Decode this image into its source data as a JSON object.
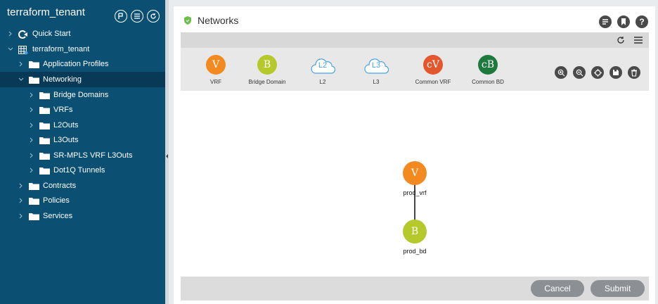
{
  "sidebar": {
    "title": "terraform_tenant",
    "header_icons": [
      "flag-icon",
      "list-icon",
      "refresh-icon"
    ],
    "items": [
      {
        "label": "Quick Start",
        "icon": "quick-start-icon"
      },
      {
        "label": "terraform_tenant",
        "icon": "tenant-icon"
      },
      {
        "label": "Application Profiles",
        "icon": "folder-icon"
      },
      {
        "label": "Networking",
        "icon": "folder-icon"
      },
      {
        "label": "Bridge Domains",
        "icon": "folder-icon"
      },
      {
        "label": "VRFs",
        "icon": "folder-icon"
      },
      {
        "label": "L2Outs",
        "icon": "folder-icon"
      },
      {
        "label": "L3Outs",
        "icon": "folder-icon"
      },
      {
        "label": "SR-MPLS VRF L3Outs",
        "icon": "folder-icon"
      },
      {
        "label": "Dot1Q Tunnels",
        "icon": "folder-icon"
      },
      {
        "label": "Contracts",
        "icon": "folder-icon"
      },
      {
        "label": "Policies",
        "icon": "folder-icon"
      },
      {
        "label": "Services",
        "icon": "folder-icon"
      }
    ]
  },
  "main": {
    "title": "Networks",
    "palette": [
      {
        "glyph": "V",
        "label": "VRF",
        "color": "#f28a1f"
      },
      {
        "glyph": "B",
        "label": "Bridge Domain",
        "color": "#b5c92b"
      },
      {
        "glyph": "L2",
        "label": "L2",
        "color": "#4aa3df"
      },
      {
        "glyph": "L3",
        "label": "L3",
        "color": "#4aa3df"
      },
      {
        "glyph": "cV",
        "label": "Common VRF",
        "color": "#e4572e"
      },
      {
        "glyph": "cB",
        "label": "Common BD",
        "color": "#1e7a3c"
      }
    ],
    "nodes": [
      {
        "glyph": "V",
        "label": "prod_vrf",
        "color": "#f28a1f"
      },
      {
        "glyph": "B",
        "label": "prod_bd",
        "color": "#b5c92b"
      }
    ],
    "cancel_label": "Cancel",
    "submit_label": "Submit"
  }
}
